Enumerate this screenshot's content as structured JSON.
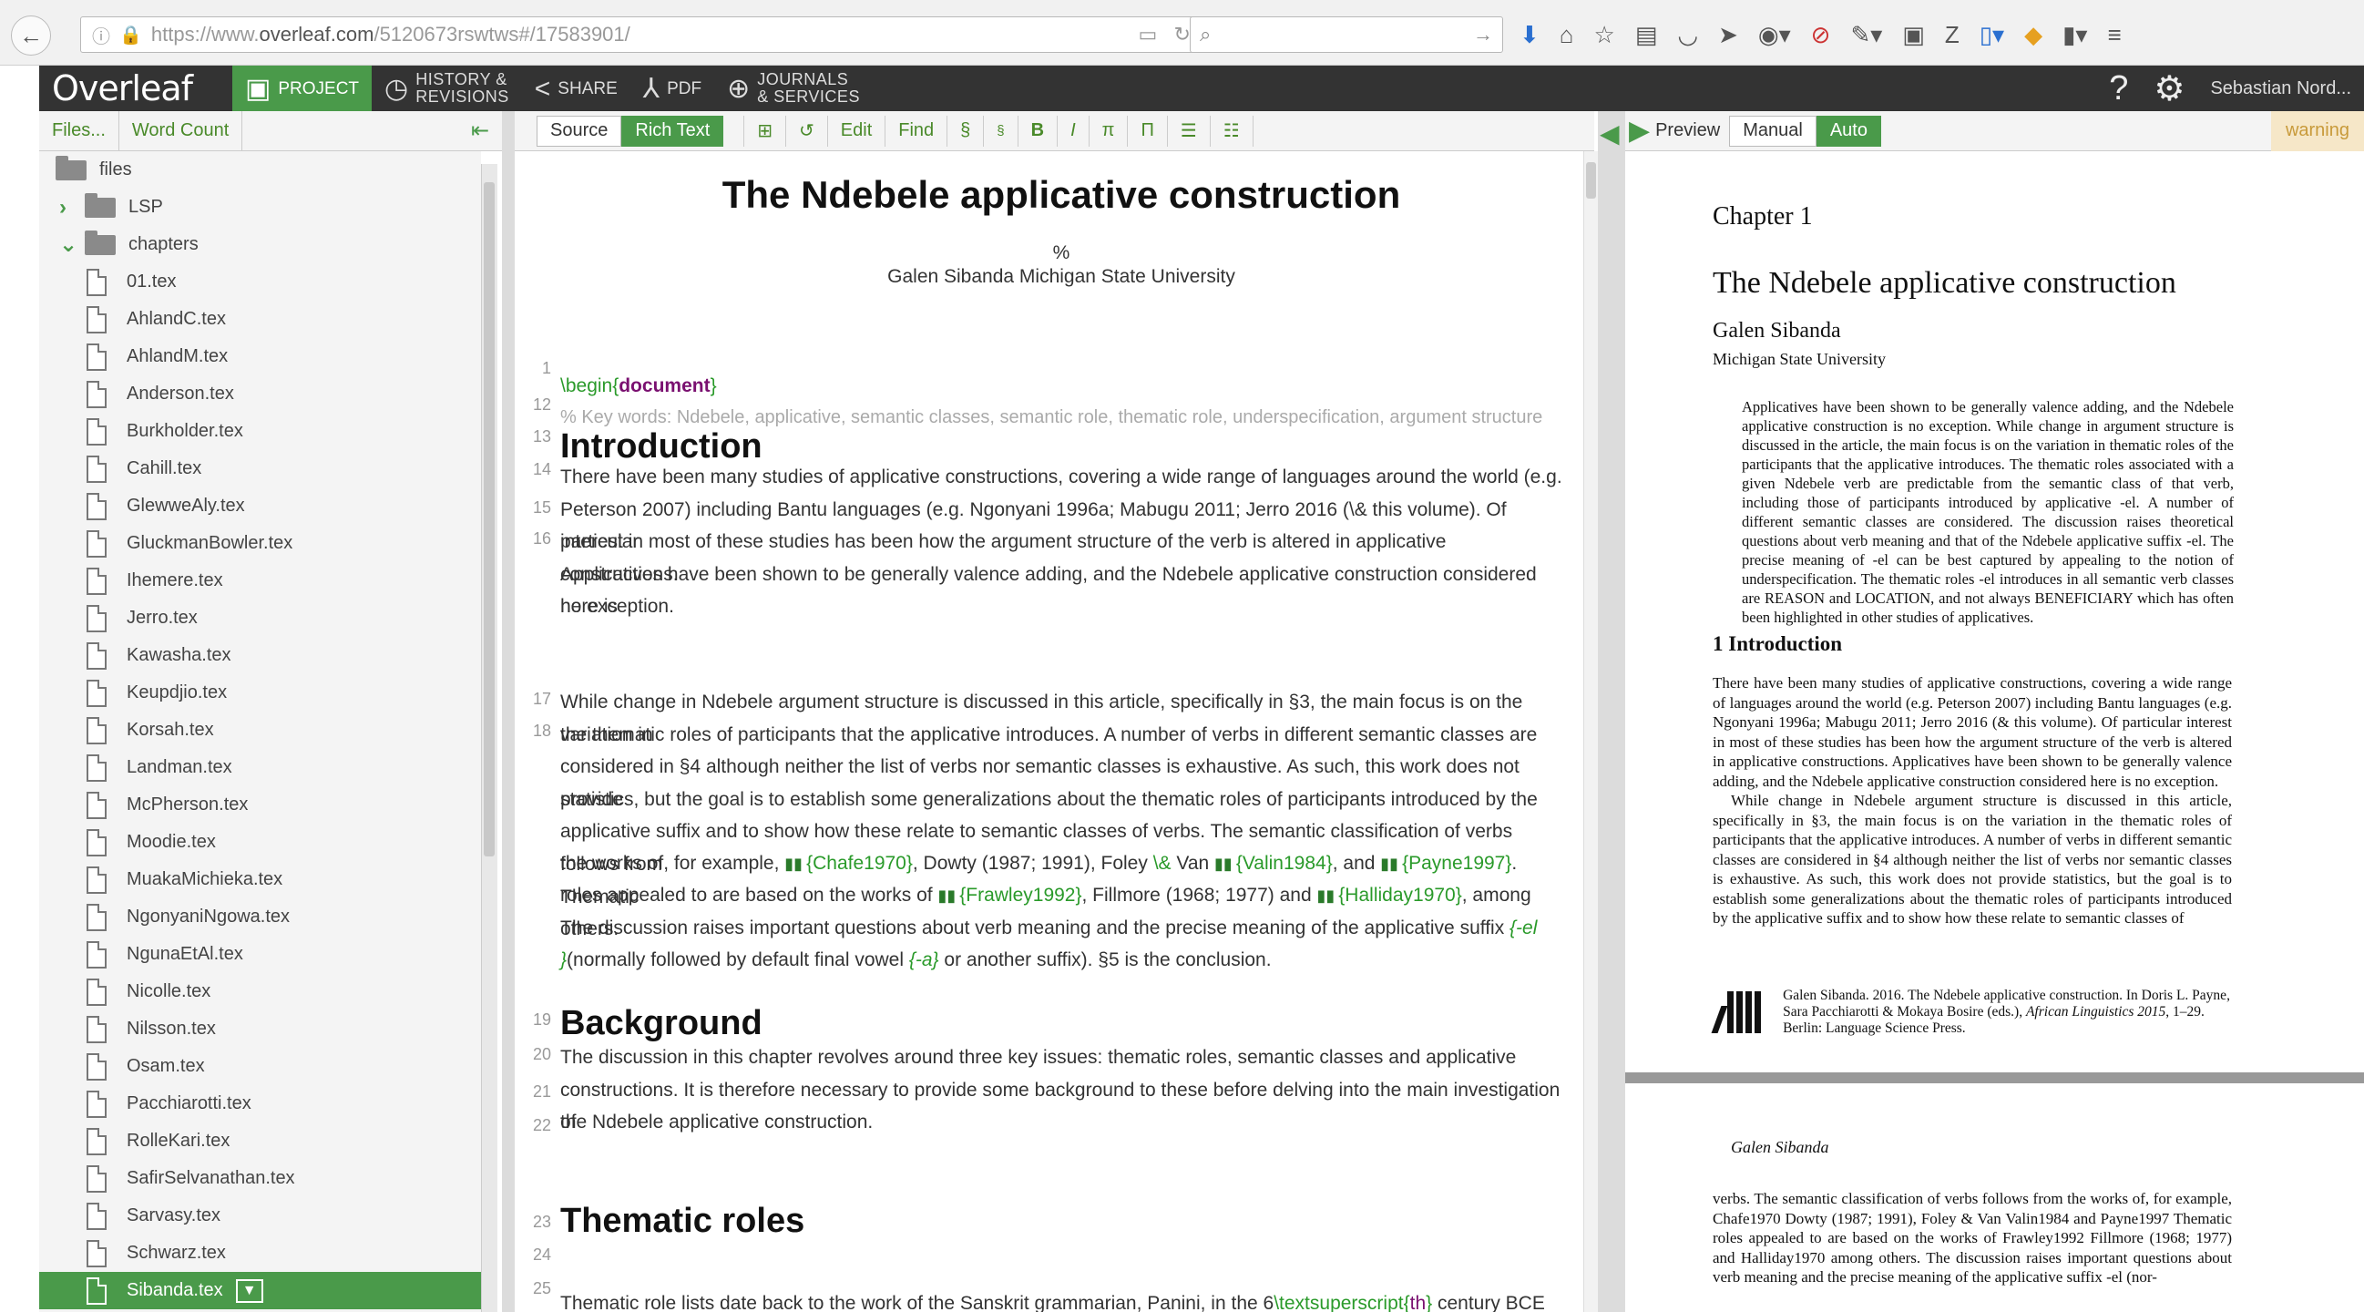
{
  "browser": {
    "url_prefix": "https://www.",
    "url_domain": "overleaf.com",
    "url_rest": "/5120673rswtws#/17583901/"
  },
  "header": {
    "logo": "Overleaf",
    "project": "PROJECT",
    "history_1": "HISTORY &",
    "history_2": "REVISIONS",
    "share": "SHARE",
    "pdf": "PDF",
    "journals_1": "JOURNALS",
    "journals_2": "& SERVICES",
    "help": "?",
    "user": "Sebastian Nord..."
  },
  "left": {
    "files_btn": "Files...",
    "wordcount_btn": "Word Count",
    "tree": [
      {
        "label": "files",
        "type": "folder",
        "chev": ""
      },
      {
        "label": "LSP",
        "type": "folder",
        "chev": "›"
      },
      {
        "label": "chapters",
        "type": "folder",
        "chev": "⌄"
      },
      {
        "label": "01.tex",
        "type": "file"
      },
      {
        "label": "AhlandC.tex",
        "type": "file"
      },
      {
        "label": "AhlandM.tex",
        "type": "file"
      },
      {
        "label": "Anderson.tex",
        "type": "file"
      },
      {
        "label": "Burkholder.tex",
        "type": "file"
      },
      {
        "label": "Cahill.tex",
        "type": "file"
      },
      {
        "label": "GlewweAly.tex",
        "type": "file"
      },
      {
        "label": "GluckmanBowler.tex",
        "type": "file"
      },
      {
        "label": "Ihemere.tex",
        "type": "file"
      },
      {
        "label": "Jerro.tex",
        "type": "file"
      },
      {
        "label": "Kawasha.tex",
        "type": "file"
      },
      {
        "label": "Keupdjio.tex",
        "type": "file"
      },
      {
        "label": "Korsah.tex",
        "type": "file"
      },
      {
        "label": "Landman.tex",
        "type": "file"
      },
      {
        "label": "McPherson.tex",
        "type": "file"
      },
      {
        "label": "Moodie.tex",
        "type": "file"
      },
      {
        "label": "MuakaMichieka.tex",
        "type": "file"
      },
      {
        "label": "NgonyaniNgowa.tex",
        "type": "file"
      },
      {
        "label": "NgunaEtAl.tex",
        "type": "file"
      },
      {
        "label": "Nicolle.tex",
        "type": "file"
      },
      {
        "label": "Nilsson.tex",
        "type": "file"
      },
      {
        "label": "Osam.tex",
        "type": "file"
      },
      {
        "label": "Pacchiarotti.tex",
        "type": "file"
      },
      {
        "label": "RolleKari.tex",
        "type": "file"
      },
      {
        "label": "SafirSelvanathan.tex",
        "type": "file"
      },
      {
        "label": "Sarvasy.tex",
        "type": "file"
      },
      {
        "label": "Schwarz.tex",
        "type": "file"
      },
      {
        "label": "Sibanda.tex",
        "type": "file",
        "selected": true
      }
    ]
  },
  "editor_toolbar": {
    "source": "Source",
    "rich_text": "Rich Text",
    "edit": "Edit",
    "find": "Find",
    "section": "§",
    "subsection": "§",
    "bold": "B",
    "italic": "I",
    "math": "π",
    "pi2": "Π"
  },
  "editor": {
    "title": "The Ndebele applicative construction",
    "percent": "%",
    "author": "Galen Sibanda Michigan State University",
    "line_numbers": [
      "1",
      "12",
      "13",
      "14",
      "15",
      "16",
      "",
      "",
      "",
      "",
      "17",
      "18",
      "",
      "",
      "",
      "",
      "",
      "",
      "",
      "19",
      "20",
      "21",
      "22",
      "",
      "",
      "23",
      "24",
      "25",
      "26"
    ],
    "begin_cmd": "\\begin{",
    "begin_arg": "document",
    "begin_close": "}",
    "keywords": "% Key words: Ndebele, applicative, semantic classes, semantic role, thematic role, underspecification, argument structure",
    "h_intro": "Introduction",
    "p16": [
      "There have been many studies of applicative constructions, covering a wide range of languages around the world (e.g.",
      "Peterson 2007) including Bantu languages (e.g. Ngonyani 1996a; Mabugu 2011; Jerro 2016 (\\& this volume). Of particular",
      "interest in most of these studies has been how the argument structure of the verb is altered in applicative constructions.",
      "Applicatives have been shown to be generally valence adding, and the Ndebele applicative construction considered here is",
      "no exception."
    ],
    "p18": [
      " While change in Ndebele argument structure is discussed in this article, specifically in §3, the main focus is on the variation in",
      "the thematic roles of participants that the applicative introduces. A number of verbs in different semantic classes are",
      "considered in §4 although neither the list of verbs nor semantic classes is exhaustive. As such, this work does not provide",
      "statistics, but the goal is to establish some generalizations about the thematic roles of participants introduced by the",
      "applicative suffix and to show how these relate to semantic classes of verbs. The semantic classification of verbs follows from"
    ],
    "p18_l6": {
      "a": "the works of, for example, ",
      "c1": "{Chafe1970}",
      "b": ", Dowty (1987; 1991), Foley ",
      "amp": "\\&",
      "c": " Van ",
      "c2": "{Valin1984}",
      "d": ", and ",
      "c3": "{Payne1997}",
      "e": ". Thematic"
    },
    "p18_l7": {
      "a": "roles appealed to are based on the works of ",
      "c1": "{Frawley1992}",
      "b": ", Fillmore (1968; 1977) and ",
      "c2": "{Halliday1970}",
      "c": ", among others."
    },
    "p18_l8": {
      "a": "The discussion raises important questions about verb meaning and the precise meaning of the applicative suffix ",
      "el": "{-el"
    },
    "p18_l9": {
      "a": "}",
      "b": "(normally followed by default final vowel ",
      "fv": "{-a}",
      "c": " or another suffix). §5 is the conclusion."
    },
    "h_background": "Background",
    "p22": [
      "The discussion in this chapter revolves around three key issues: thematic roles, semantic classes and applicative",
      "constructions. It is therefore necessary to provide some background to these before delving into the main investigation of",
      "the Ndebele applicative construction."
    ],
    "h_thematic": "Thematic roles",
    "p26": {
      "a": "Thematic role lists date back to the work of the Sanskrit grammarian, Panini, in the 6",
      "cmd": "\\textsuperscript{",
      "arg": "th",
      "close": "}",
      "b": " century BCE (Dowty"
    }
  },
  "preview_toolbar": {
    "preview": "Preview",
    "manual": "Manual",
    "auto": "Auto",
    "warning": "warning"
  },
  "preview": {
    "chapter": "Chapter 1",
    "title": "The Ndebele applicative construction",
    "author": "Galen Sibanda",
    "affiliation": "Michigan State University",
    "abstract": "Applicatives have been shown to be generally valence adding, and the Ndebele applicative construction is no exception. While change in argument structure is discussed in the article, the main focus is on the variation in thematic roles of the participants that the applicative introduces. The thematic roles associated with a given Ndebele verb are predictable from the semantic class of that verb, including those of participants introduced by applicative -el. A number of different semantic classes are considered. The discussion raises theoretical questions about verb meaning and that of the Ndebele applicative suffix -el. The precise meaning of -el can be best captured by appealing to the notion of underspecification. The thematic roles -el introduces in all semantic verb classes are REASON and LOCATION, and not always BENEFICIARY which has often been highlighted in other studies of applicatives.",
    "section": "1  Introduction",
    "body1": "There have been many studies of applicative constructions, covering a wide range of languages around the world (e.g. Peterson 2007) including Bantu languages (e.g. Ngonyani 1996a; Mabugu 2011; Jerro 2016 (& this volume). Of particular interest in most of these studies has been how the argument structure of the verb is altered in applicative constructions. Applicatives have been shown to be generally valence adding, and the Ndebele applicative construction considered here is no exception.",
    "body2": "While change in Ndebele argument structure is discussed in this article, specifically in §3, the main focus is on the variation in the thematic roles of participants that the applicative introduces. A number of verbs in different semantic classes are considered in §4 although neither the list of verbs nor semantic classes is exhaustive. As such, this work does not provide statistics, but the goal is to establish some generalizations about the thematic roles of participants introduced by the applicative suffix and to show how these relate to semantic classes of",
    "footer_a": "Galen Sibanda. 2016. The Ndebele applicative construction. In Doris L. Payne, Sara Pacchiarotti & Mokaya Bosire (eds.), ",
    "footer_it": "African Linguistics 2015",
    "footer_b": ", 1–29. Berlin: Language Science Press.",
    "running_head": "Galen Sibanda",
    "page2": "verbs. The semantic classification of verbs follows from the works of, for example, Chafe1970 Dowty (1987; 1991), Foley & Van Valin1984 and Payne1997 Thematic roles appealed to are based on the works of Frawley1992 Fillmore (1968; 1977) and Halliday1970 among others. The discussion raises important questions about verb meaning and the precise meaning of the applicative suffix -el (nor-"
  },
  "colors": {
    "accent": "#4a9a4a",
    "header_bg": "#333333",
    "latex_cmd": "#2a9a2a",
    "latex_arg": "#7a1070"
  }
}
